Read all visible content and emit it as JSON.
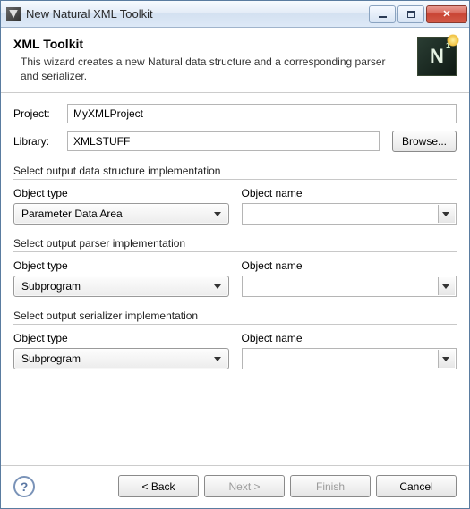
{
  "window": {
    "title": "New Natural XML Toolkit"
  },
  "header": {
    "title": "XML Toolkit",
    "description": "This wizard creates a new Natural data structure and a corresponding parser and serializer.",
    "icon_letter": "N",
    "icon_sup": "1"
  },
  "fields": {
    "project_label": "Project:",
    "project_value": "MyXMLProject",
    "library_label": "Library:",
    "library_value": "XMLSTUFF",
    "browse_label": "Browse..."
  },
  "groups": {
    "data_structure": {
      "title": "Select output data structure implementation",
      "type_label": "Object type",
      "name_label": "Object name",
      "type_value": "Parameter Data Area",
      "name_value": ""
    },
    "parser": {
      "title": "Select output parser implementation",
      "type_label": "Object type",
      "name_label": "Object name",
      "type_value": "Subprogram",
      "name_value": ""
    },
    "serializer": {
      "title": "Select output serializer implementation",
      "type_label": "Object type",
      "name_label": "Object name",
      "type_value": "Subprogram",
      "name_value": ""
    }
  },
  "buttons": {
    "back": "< Back",
    "next": "Next >",
    "finish": "Finish",
    "cancel": "Cancel",
    "help": "?"
  }
}
